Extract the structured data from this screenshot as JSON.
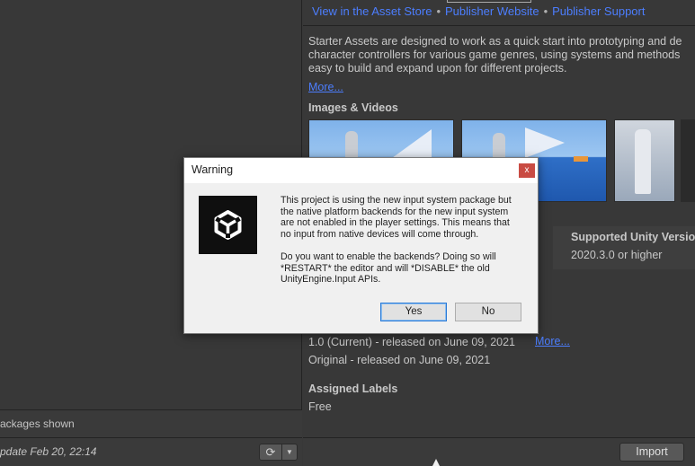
{
  "left_panel": {
    "packages_shown": "ackages shown",
    "last_update": "pdate Feb 20, 22:14",
    "refresh_icon": "⟳",
    "dropdown_icon": "▼"
  },
  "asset": {
    "links": [
      "View in the Asset Store",
      "Publisher Website",
      "Publisher Support"
    ],
    "link_separator": "•",
    "description_lines": [
      "Starter Assets are designed to work as a quick start into prototyping and de",
      "character controllers for various game genres, using systems and methods",
      "easy to build and expand upon for different projects."
    ],
    "more_label": "More...",
    "images_title": "Images & Videos",
    "supported_title": "Supported Unity Versio",
    "supported_value": "2020.3.0 or higher",
    "versions": [
      "1.0 (Current) - released on June 09, 2021",
      "Original - released on June 09, 2021"
    ],
    "versions_more_label": "More...",
    "labels_title": "Assigned Labels",
    "labels_value": "Free",
    "import_label": "Import"
  },
  "dialog": {
    "title": "Warning",
    "close_glyph": "x",
    "icon": "unity-logo-icon",
    "message_para1": [
      "This project is using the new input system package but",
      "the native platform backends for the new input system",
      "are not enabled in the player settings. This means that",
      "no input from native devices will come through."
    ],
    "message_para2": [
      "Do you want to enable the backends? Doing so will",
      "*RESTART* the editor and will *DISABLE* the old",
      "UnityEngine.Input APIs."
    ],
    "yes_label": "Yes",
    "no_label": "No"
  },
  "colors": {
    "link": "#4c7eff",
    "panel_bg": "#383838",
    "dialog_bg": "#f0f0f0",
    "close_red": "#c94b43",
    "yes_focus": "#2a7ad6"
  }
}
